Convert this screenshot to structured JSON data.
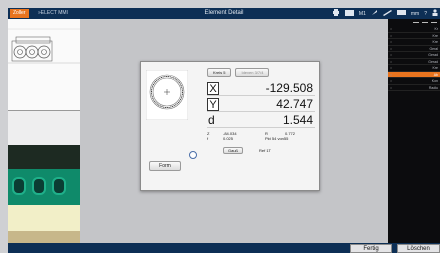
{
  "topbar": {
    "brand": "Zoller",
    "brand_suffix": "»ELECT MMI",
    "title": "Element Detail",
    "status_text": "M1",
    "unit": "mm",
    "help": "?"
  },
  "dialog": {
    "tabs": [
      "Kreis 5",
      "Ideven 3/7/4"
    ],
    "readouts": [
      {
        "axis": "X",
        "value": "-129.508"
      },
      {
        "axis": "Y",
        "value": "42.747"
      },
      {
        "axis": "d",
        "value": "1.544"
      }
    ],
    "details": {
      "z_label": "Z",
      "z_value": "-84.034",
      "r_label": "R",
      "r_value": "0.772",
      "f_label": "f",
      "f_value": "0.025",
      "pkt_text": "Pkt 54 von55",
      "gauss_label": "Gauß",
      "ref_text": "Ref 1T"
    },
    "form_button": "Form"
  },
  "rightpanel": {
    "rows": [
      {
        "label": "Kr",
        "selected": false
      },
      {
        "label": "Kre",
        "selected": false
      },
      {
        "label": "Kre",
        "selected": false
      },
      {
        "label": "Geral",
        "selected": false
      },
      {
        "label": "Gerad",
        "selected": false
      },
      {
        "label": "Gerad",
        "selected": false
      },
      {
        "label": "Kre",
        "selected": false
      },
      {
        "label": "Ab",
        "selected": true
      },
      {
        "label": "Kon",
        "selected": false
      },
      {
        "label": "Radiu",
        "selected": false
      }
    ]
  },
  "bottombar": {
    "done": "Fertig",
    "delete": "Löschen"
  },
  "colors": {
    "titlebar": "#0d2f55",
    "accent": "#e8741f",
    "panel_dark": "#0c0c0e"
  }
}
